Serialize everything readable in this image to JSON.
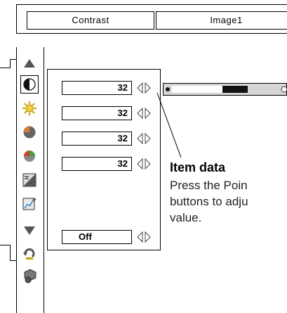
{
  "menu": {
    "tab_contrast": "Contrast",
    "tab_image": "Image1"
  },
  "rows": [
    {
      "value": "32"
    },
    {
      "value": "32"
    },
    {
      "value": "32"
    },
    {
      "value": "32"
    },
    {
      "value": "Off"
    }
  ],
  "slider": {
    "value": 32
  },
  "callout": {
    "title": "Item data",
    "line1": "Press the Poin",
    "line2": "buttons to adju",
    "line3": "value."
  },
  "icons": [
    "up-triangle-icon",
    "contrast-icon",
    "brightness-icon",
    "color-icon",
    "tint-icon",
    "sharpness-icon",
    "gamma-icon",
    "down-triangle-icon",
    "reset-icon",
    "store-icon"
  ]
}
